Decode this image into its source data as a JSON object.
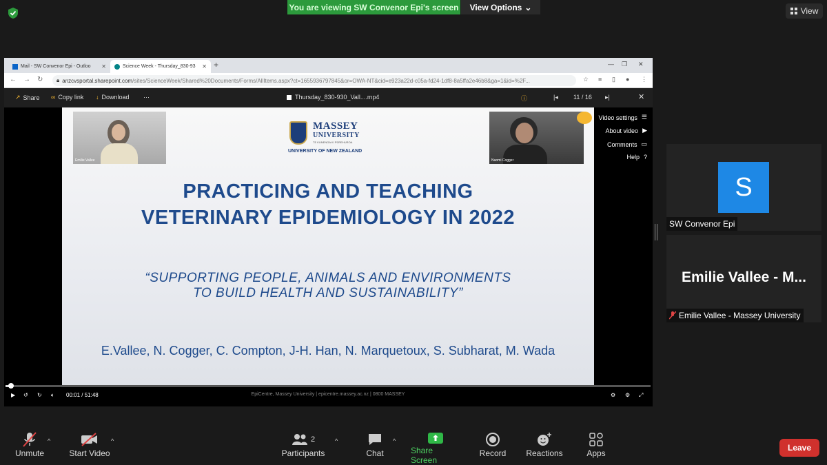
{
  "zoom": {
    "share_banner": "You are viewing SW Convenor Epi's screen",
    "view_options": "View Options",
    "view_button": "View",
    "accent_green": "#2c9a3c",
    "leave_color": "#d0312d"
  },
  "browser": {
    "tabs": [
      {
        "title": "Mail - SW Convenor Epi - Outloo"
      },
      {
        "title": "Science Week - Thursday_830-93"
      }
    ],
    "url_host": "anzcvsportal.sharepoint.com",
    "url_path": "/sites/ScienceWeek/Shared%20Documents/Forms/AllItems.aspx?ct=1655936797845&or=OWA-NT&cid=e923a22d-c05a-fd24-1df8-8a5ffa2e46b8&ga=1&id=%2F..."
  },
  "sharepoint": {
    "share": "Share",
    "copy_link": "Copy link",
    "download": "Download",
    "more": "···",
    "filename": "Thursday_830-930_Vall....mp4",
    "page_counter": "11 / 16"
  },
  "slide": {
    "cam1_label": "Emilie Vallee",
    "cam2_label": "Naomi Cogger",
    "logo_name_line1": "MASSEY",
    "logo_name_line2": "UNIVERSITY",
    "logo_sub": "TE KUNENGA KI PŪREHUROA",
    "logo_uni": "UNIVERSITY OF NEW ZEALAND",
    "title_line1": "PRACTICING AND TEACHING",
    "title_line2": "VETERINARY EPIDEMIOLOGY IN 2022",
    "quote_line1": "“SUPPORTING PEOPLE, ANIMALS AND ENVIRONMENTS",
    "quote_line2": "TO BUILD HEALTH AND SUSTAINABILITY”",
    "authors": "E.Vallee, N. Cogger, C. Compton, J-H. Han, N. Marquetoux, S. Subharat, M. Wada",
    "footer": "EpiCentre, Massey University  |  epicentre.massey.ac.nz  |  0800 MASSEY"
  },
  "video_menu": {
    "items": [
      "Video settings",
      "About video",
      "Comments",
      "Help"
    ]
  },
  "player": {
    "time_current": "00:01",
    "time_sep": "/",
    "time_total": "51:48",
    "progress_fraction": 0.004
  },
  "participants_panel": {
    "p1_initial": "S",
    "p1_name": "SW Convenor Epi",
    "p2_big": "Emilie Vallee - M...",
    "p2_name": "Emilie Vallee - Massey University"
  },
  "toolbar": {
    "unmute": "Unmute",
    "start_video": "Start Video",
    "participants": "Participants",
    "participants_count": "2",
    "chat": "Chat",
    "share_screen": "Share Screen",
    "record": "Record",
    "reactions": "Reactions",
    "apps": "Apps",
    "leave": "Leave"
  }
}
